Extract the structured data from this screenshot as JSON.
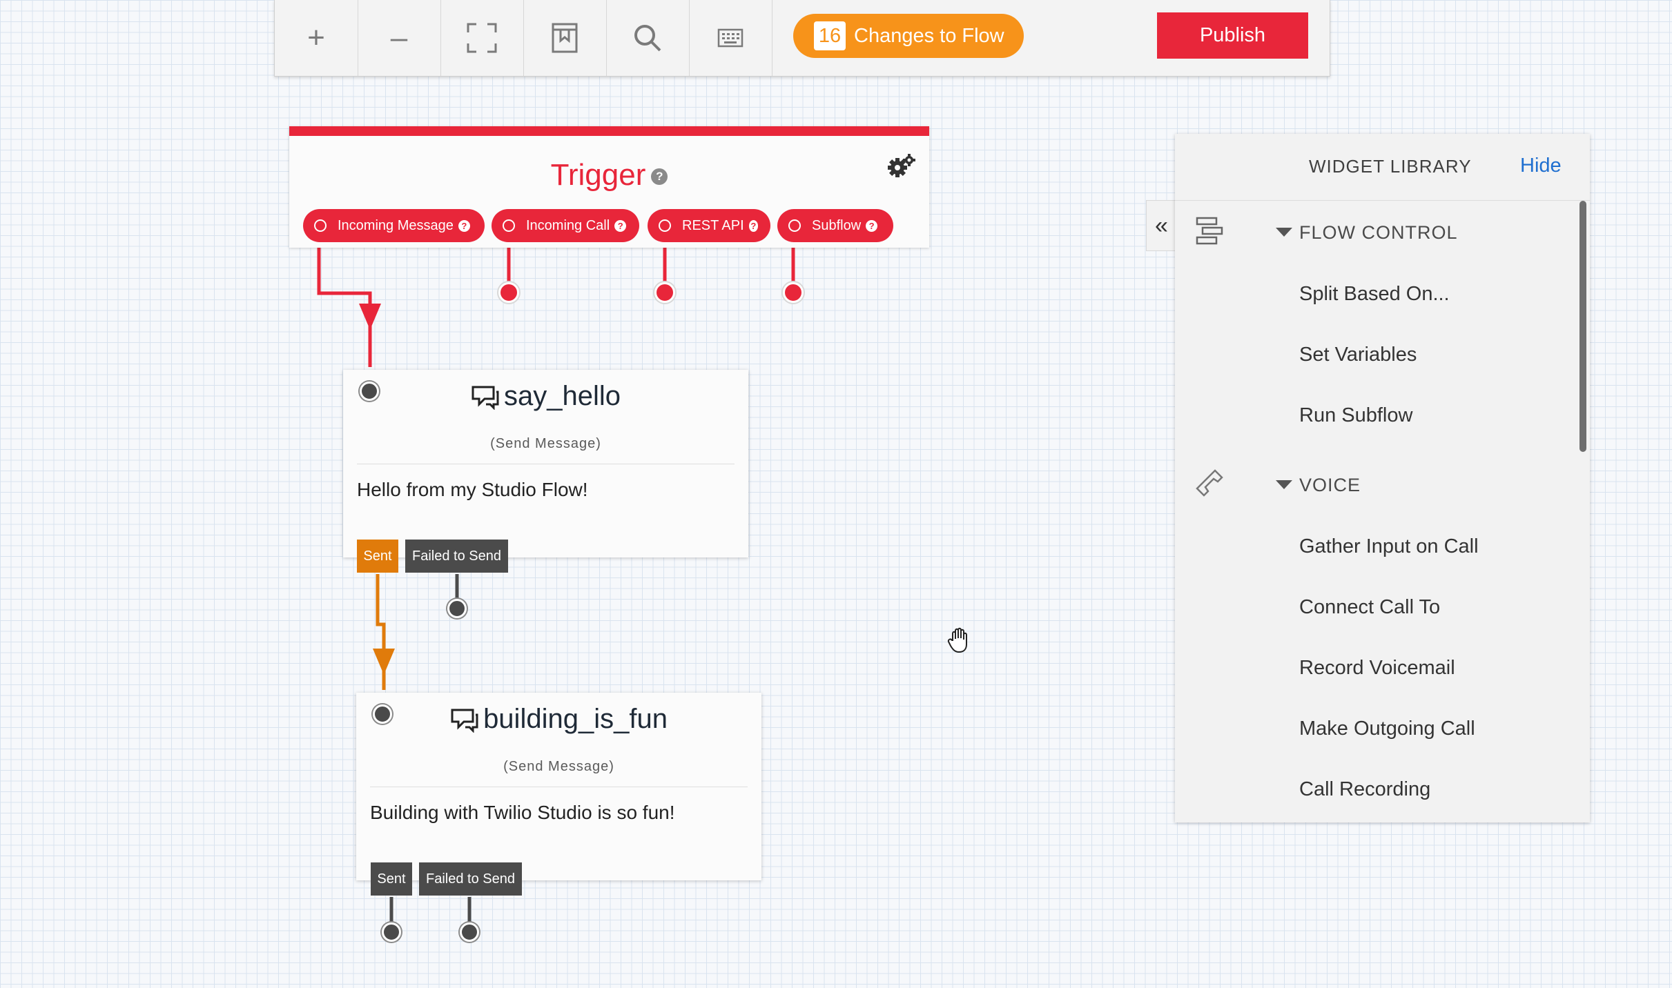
{
  "toolbar": {
    "zoom_in_label": "+",
    "zoom_out_label": "–",
    "changes_count": "16",
    "changes_label": "Changes to Flow",
    "publish_label": "Publish"
  },
  "trigger": {
    "title": "Trigger",
    "transitions": [
      {
        "label": "Incoming Message"
      },
      {
        "label": "Incoming Call"
      },
      {
        "label": "REST API"
      },
      {
        "label": "Subflow"
      }
    ]
  },
  "widgets": [
    {
      "name": "say_hello",
      "type": "(Send Message)",
      "body": "Hello from my Studio Flow!",
      "transitions": {
        "sent": "Sent",
        "failed": "Failed to Send"
      }
    },
    {
      "name": "building_is_fun",
      "type": "(Send Message)",
      "body": "Building with Twilio Studio is so fun!",
      "transitions": {
        "sent": "Sent",
        "failed": "Failed to Send"
      }
    }
  ],
  "library": {
    "title": "WIDGET LIBRARY",
    "hide_label": "Hide",
    "collapse_label": "«",
    "sections": [
      {
        "label": "FLOW CONTROL",
        "items": [
          "Split Based On...",
          "Set Variables",
          "Run Subflow"
        ]
      },
      {
        "label": "VOICE",
        "items": [
          "Gather Input on Call",
          "Connect Call To",
          "Record Voicemail",
          "Make Outgoing Call",
          "Call Recording"
        ]
      }
    ]
  },
  "colors": {
    "accent_red": "#e8263a",
    "accent_orange": "#f7931a",
    "sent_orange": "#e07b0b",
    "link_blue": "#1f6fd0"
  }
}
